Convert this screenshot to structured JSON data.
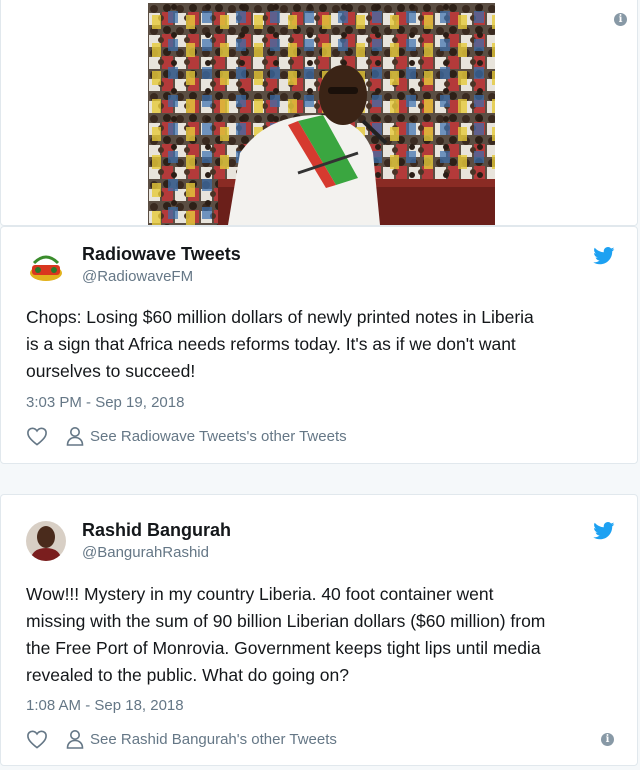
{
  "photo_card": {
    "alt": "Speaker at podium with crowd"
  },
  "tweets": [
    {
      "name": "Radiowave Tweets",
      "handle": "@RadiowaveFM",
      "text_lines": [
        "Chops: Losing $60 million dollars of newly printed notes in Liberia",
        "is a sign that Africa needs reforms today. It's as if we don't want",
        "ourselves to succeed!"
      ],
      "timestamp": "3:03 PM - Sep 19, 2018",
      "other_label": "See Radiowave Tweets's other Tweets",
      "avatar_icon": "radio-logo-icon"
    },
    {
      "name": "Rashid Bangurah",
      "handle": "@BangurahRashid",
      "text_lines": [
        "Wow!!! Mystery in my country Liberia. 40 foot container went",
        "missing with the sum of 90 billion Liberian dollars ($60 million) from",
        "the Free Port of Monrovia. Government keeps tight lips until media",
        "revealed to the public. What do going on?"
      ],
      "timestamp": "1:08 AM - Sep 18, 2018",
      "other_label": "See Rashid Bangurah's other Tweets",
      "avatar_icon": "user-photo-icon"
    }
  ],
  "colors": {
    "twitter_blue": "#1da1f2",
    "secondary_text": "#657786",
    "primary_text": "#14171a",
    "border": "#e1e8ed"
  },
  "icons": {
    "info": "info-icon",
    "bird": "twitter-bird-icon",
    "like": "heart-icon",
    "profile": "person-icon"
  }
}
